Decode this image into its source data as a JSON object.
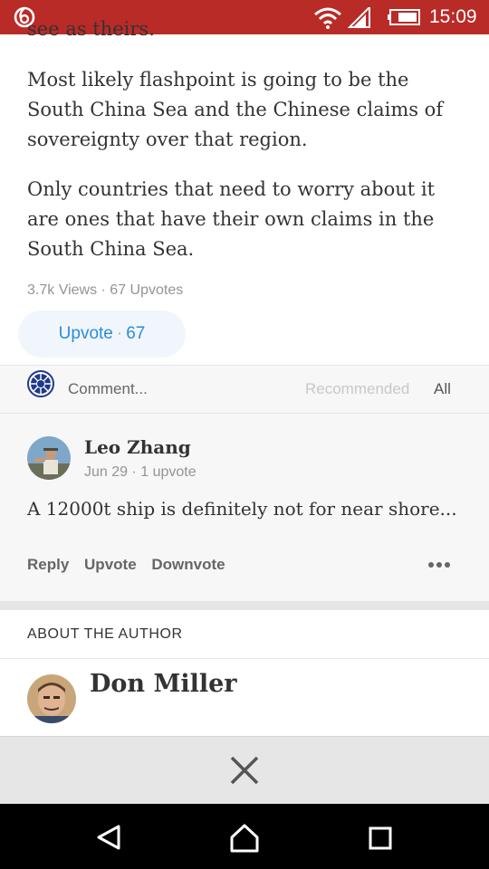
{
  "status_bar": {
    "time": "15:09",
    "icons": [
      "app-icon",
      "wifi-icon",
      "signal-icon",
      "battery-icon"
    ],
    "color": "#b92b27"
  },
  "answer": {
    "cut_line": "see as theirs.",
    "paragraphs": [
      "Most likely flashpoint is going to be the South China Sea and the Chinese claims of sovereignty over that region.",
      "Only countries that need to worry about it are ones that have their own claims in the South China Sea."
    ],
    "stats": "3.7k Views · 67 Upvotes",
    "upvote_label": "Upvote",
    "upvote_count": "67"
  },
  "comments": {
    "input_placeholder": "Comment...",
    "tabs": [
      "Recommended",
      "All"
    ],
    "items": [
      {
        "author": "Leo Zhang",
        "meta": "Jun 29 · 1 upvote",
        "text": "A 12000t ship is definitely not for near shore...",
        "actions": [
          "Reply",
          "Upvote",
          "Downvote"
        ]
      }
    ]
  },
  "about": {
    "header": "ABOUT THE AUTHOR",
    "author_name": "Don Miller"
  },
  "nav_icons": [
    "back-icon",
    "home-icon",
    "recents-icon"
  ]
}
